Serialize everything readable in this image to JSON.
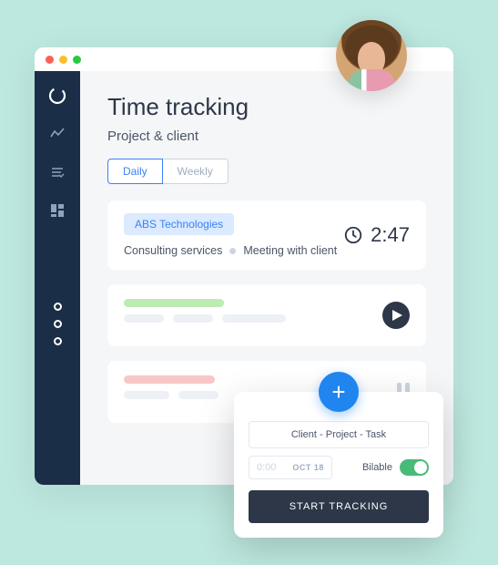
{
  "header": {
    "title": "Time tracking",
    "subtitle": "Project & client"
  },
  "tabs": [
    {
      "label": "Daily",
      "active": true
    },
    {
      "label": "Weekly",
      "active": false
    }
  ],
  "entry": {
    "client_tag": "ABS Technologies",
    "project": "Consulting services",
    "task": "Meeting with client",
    "time": "2:47"
  },
  "popover": {
    "placeholder": "Client  -  Project  -  Task",
    "time_placeholder": "0:00",
    "date": "OCT 18",
    "billable_label": "Bilable",
    "billable": true,
    "button": "START TRACKING"
  },
  "colors": {
    "accent": "#2185F0",
    "sidebar": "#1A2E47",
    "success": "#48BB78"
  }
}
